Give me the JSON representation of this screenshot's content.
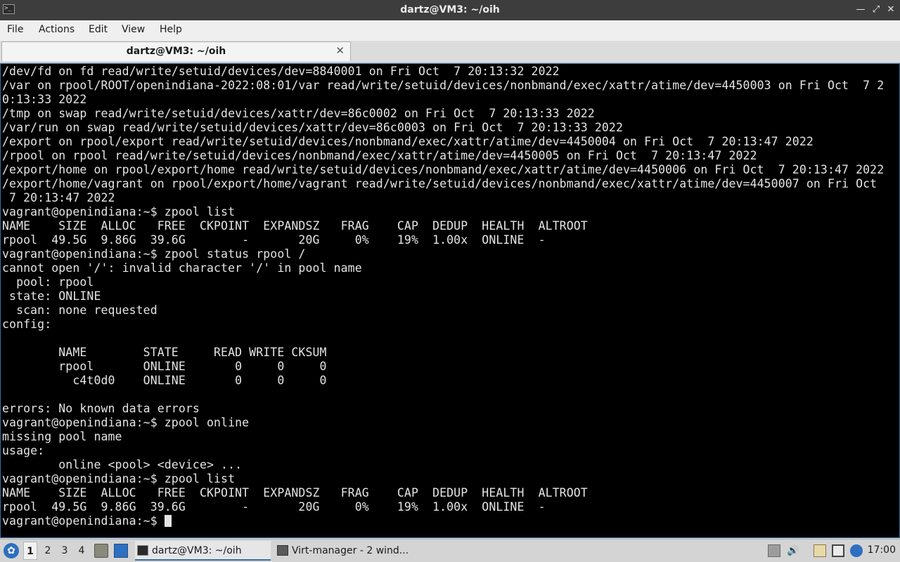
{
  "window": {
    "title": "dartz@VM3: ~/oih",
    "controls": [
      "minimize",
      "maximize",
      "close"
    ]
  },
  "menu": [
    "File",
    "Actions",
    "Edit",
    "View",
    "Help"
  ],
  "tabs": [
    {
      "label": "dartz@VM3: ~/oih"
    }
  ],
  "terminal": {
    "lines": [
      "/dev/fd on fd read/write/setuid/devices/dev=8840001 on Fri Oct  7 20:13:32 2022",
      "/var on rpool/ROOT/openindiana-2022:08:01/var read/write/setuid/devices/nonbmand/exec/xattr/atime/dev=4450003 on Fri Oct  7 2",
      "0:13:33 2022",
      "/tmp on swap read/write/setuid/devices/xattr/dev=86c0002 on Fri Oct  7 20:13:33 2022",
      "/var/run on swap read/write/setuid/devices/xattr/dev=86c0003 on Fri Oct  7 20:13:33 2022",
      "/export on rpool/export read/write/setuid/devices/nonbmand/exec/xattr/atime/dev=4450004 on Fri Oct  7 20:13:47 2022",
      "/rpool on rpool read/write/setuid/devices/nonbmand/exec/xattr/atime/dev=4450005 on Fri Oct  7 20:13:47 2022",
      "/export/home on rpool/export/home read/write/setuid/devices/nonbmand/exec/xattr/atime/dev=4450006 on Fri Oct  7 20:13:47 2022",
      "/export/home/vagrant on rpool/export/home/vagrant read/write/setuid/devices/nonbmand/exec/xattr/atime/dev=4450007 on Fri Oct",
      " 7 20:13:47 2022",
      "vagrant@openindiana:~$ zpool list",
      "NAME    SIZE  ALLOC   FREE  CKPOINT  EXPANDSZ   FRAG    CAP  DEDUP  HEALTH  ALTROOT",
      "rpool  49.5G  9.86G  39.6G        -       20G     0%    19%  1.00x  ONLINE  -",
      "vagrant@openindiana:~$ zpool status rpool /",
      "cannot open '/': invalid character '/' in pool name",
      "  pool: rpool",
      " state: ONLINE",
      "  scan: none requested",
      "config:",
      "",
      "        NAME        STATE     READ WRITE CKSUM",
      "        rpool       ONLINE       0     0     0",
      "          c4t0d0    ONLINE       0     0     0",
      "",
      "errors: No known data errors",
      "vagrant@openindiana:~$ zpool online",
      "missing pool name",
      "usage:",
      "        online <pool> <device> ...",
      "vagrant@openindiana:~$ zpool list",
      "NAME    SIZE  ALLOC   FREE  CKPOINT  EXPANDSZ   FRAG    CAP  DEDUP  HEALTH  ALTROOT",
      "rpool  49.5G  9.86G  39.6G        -       20G     0%    19%  1.00x  ONLINE  -"
    ],
    "prompt": "vagrant@openindiana:~$ "
  },
  "taskbar": {
    "workspaces": [
      "1",
      "2",
      "3",
      "4"
    ],
    "active_workspace": "1",
    "tasks": [
      {
        "label": "dartz@VM3: ~/oih",
        "icon": "terminal-icon",
        "active": true
      },
      {
        "label": "Virt-manager - 2 wind...",
        "icon": "virt-manager-icon",
        "active": false
      }
    ],
    "clock": "17:00"
  },
  "colors": {
    "terminal_bg": "#000000",
    "terminal_fg": "#e4e4e4",
    "accent": "#3a6ea5",
    "titlebar": "#3d3d3d"
  }
}
